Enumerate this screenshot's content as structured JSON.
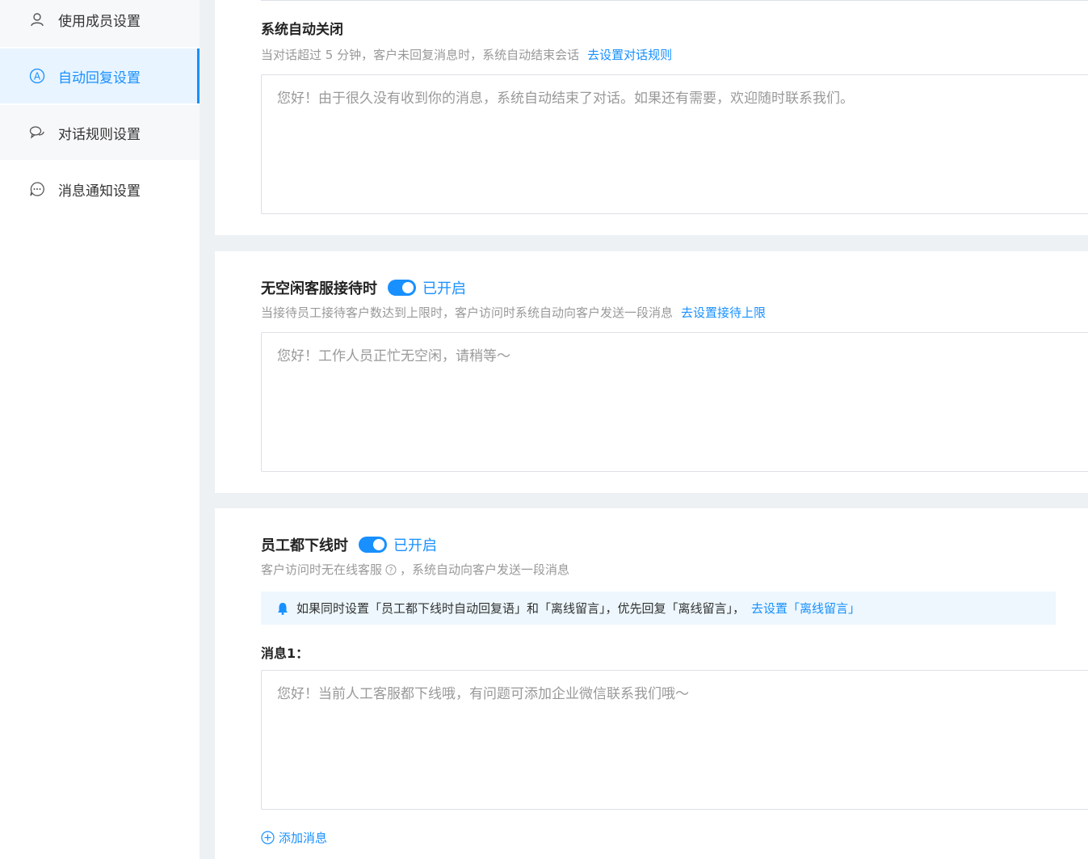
{
  "sidebar": {
    "items": [
      {
        "label": "使用成员设置",
        "icon": "user-icon"
      },
      {
        "label": "自动回复设置",
        "icon": "auto-reply-icon"
      },
      {
        "label": "对话规则设置",
        "icon": "chat-bubbles-icon"
      },
      {
        "label": "消息通知设置",
        "icon": "message-dots-icon"
      }
    ],
    "active_index": 1
  },
  "auto_close": {
    "title": "系统自动关闭",
    "desc": "当对话超过 5 分钟，客户未回复消息时，系统自动结束会话",
    "link": "去设置对话规则",
    "message": "您好！由于很久没有收到你的消息，系统自动结束了对话。如果还有需要，欢迎随时联系我们。"
  },
  "no_idle": {
    "title": "无空闲客服接待时",
    "toggle_label": "已开启",
    "desc": "当接待员工接待客户数达到上限时，客户访问时系统自动向客户发送一段消息",
    "link": "去设置接待上限",
    "message": "您好！工作人员正忙无空闲，请稍等～"
  },
  "offline": {
    "title": "员工都下线时",
    "toggle_label": "已开启",
    "desc_prefix": "客户访问时无在线客服",
    "desc_suffix": "，系统自动向客户发送一段消息",
    "notice_text": "如果同时设置「员工都下线时自动回复语」和「离线留言」，优先回复「离线留言」，",
    "notice_link": "去设置「离线留言」",
    "message_label": "消息1：",
    "message": "您好！当前人工客服都下线哦，有问题可添加企业微信联系我们哦～",
    "add_label": "添加消息"
  },
  "colors": {
    "accent": "#1890ff",
    "notice_bg": "#edf7fd",
    "page_bg": "#eef1f4"
  }
}
